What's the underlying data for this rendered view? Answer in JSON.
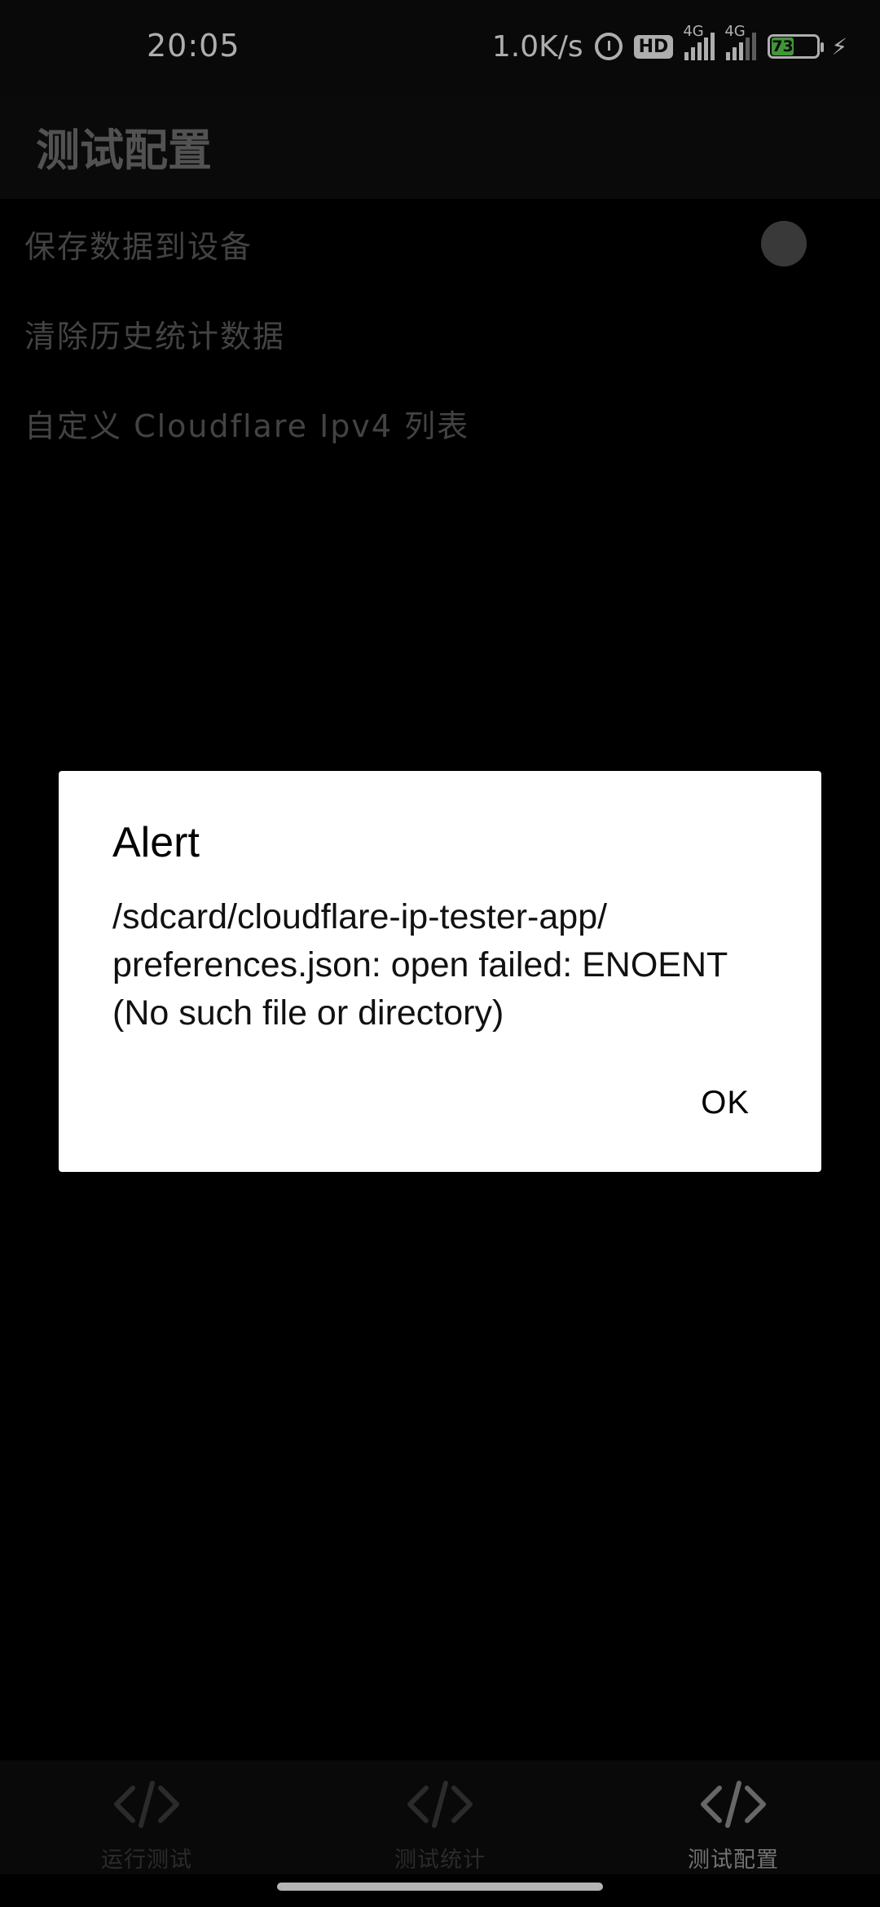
{
  "status_bar": {
    "time": "20:05",
    "net_speed": "1.0K/s",
    "hd_label": "HD",
    "signal_1_tag": "4G",
    "signal_2_tag": "4G",
    "battery_level": "73",
    "icons": [
      "alarm-icon",
      "hd-icon",
      "signal-icon",
      "signal-icon",
      "battery-icon",
      "charging-bolt-icon"
    ]
  },
  "app_bar": {
    "title": "测试配置"
  },
  "settings": {
    "items": [
      {
        "label": "保存数据到设备",
        "has_toggle": true
      },
      {
        "label": "清除历史统计数据"
      },
      {
        "label": "自定义 Cloudflare Ipv4 列表"
      }
    ]
  },
  "dialog": {
    "title": "Alert",
    "message": "/sdcard/cloudflare-ip-tester-app/ preferences.json: open failed: ENOENT (No such file or directory)",
    "ok_label": "OK"
  },
  "bottom_nav": {
    "items": [
      {
        "label": "运行测试",
        "icon": "code-icon"
      },
      {
        "label": "测试统计",
        "icon": "code-icon"
      },
      {
        "label": "测试配置",
        "icon": "code-icon",
        "active": true
      }
    ]
  },
  "colors": {
    "background": "#000000",
    "dialog_background": "#ffffff",
    "battery_fill": "#59c94a"
  }
}
